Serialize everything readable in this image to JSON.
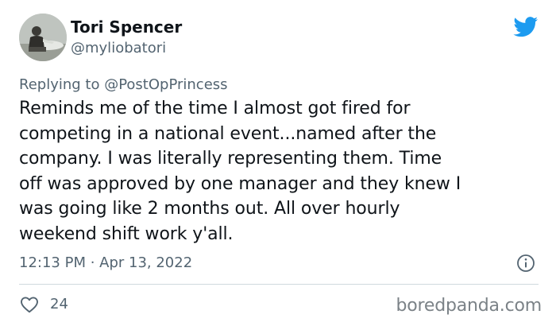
{
  "author": {
    "name": "Tori Spencer",
    "handle": "@myliobatori",
    "avatar_icon": "avatar-photo"
  },
  "brand": {
    "icon": "twitter-bird-icon",
    "color": "#1d9bf0"
  },
  "reply": {
    "prefix": "Replying to ",
    "mention": "@PostOpPrincess"
  },
  "tweet": {
    "lines": [
      "Reminds me of the time I almost got fired for",
      "competing in a national event...named after the",
      "company. I was literally representing them. Time",
      "off was approved by one manager and they knew I",
      "was going like 2 months out. All over hourly",
      "weekend shift work y'all."
    ]
  },
  "meta": {
    "timestamp": "12:13 PM · Apr 13, 2022",
    "info_icon": "info-icon"
  },
  "actions": {
    "like_icon": "heart-icon",
    "like_count": "24"
  },
  "watermark": "boredpanda.com"
}
